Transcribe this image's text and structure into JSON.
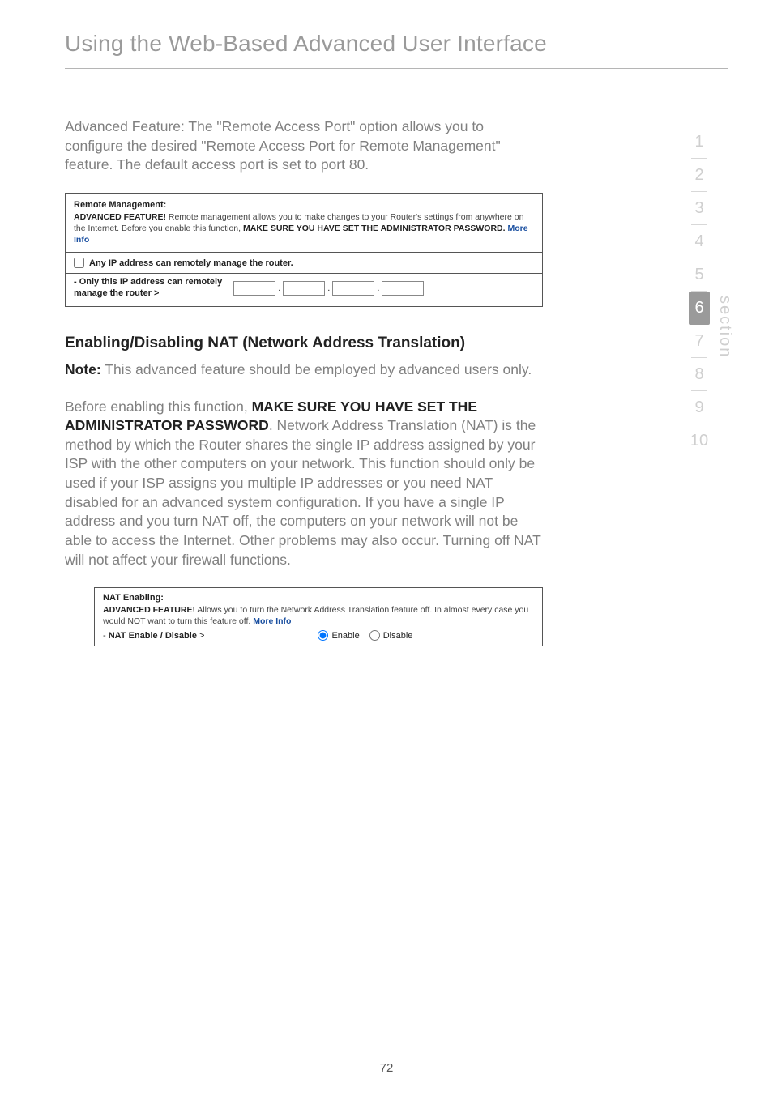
{
  "page_title": "Using the Web-Based Advanced User Interface",
  "intro_para": "Advanced Feature: The \"Remote Access Port\" option allows you to configure the desired \"Remote Access Port for Remote Management\" feature. The default access port is set to port 80.",
  "remote_panel": {
    "heading": "Remote Management:",
    "text_pre": "ADVANCED FEATURE!",
    "text_mid": " Remote management allows you to make changes to your Router's settings from anywhere on the Internet. Before you enable this function, ",
    "text_bold2": "MAKE SURE YOU HAVE SET THE ADMINISTRATOR PASSWORD.",
    "more_info": "More Info",
    "checkbox_label": "Any IP address can remotely manage the router.",
    "ip_label_line1": "- Only this IP address can remotely",
    "ip_label_line2": "manage the router >"
  },
  "nat_heading": "Enabling/Disabling NAT (Network Address Translation)",
  "nat_note_bold": "Note:",
  "nat_note_rest": " This advanced feature should be employed by advanced users only.",
  "nat_para_pre": "Before enabling this function, ",
  "nat_para_bold": "MAKE SURE YOU HAVE SET THE ADMINISTRATOR PASSWORD",
  "nat_para_rest": ". Network Address Translation (NAT) is the method by which the Router shares the single IP address assigned by your ISP with the other computers on your network. This function should only be used if your ISP assigns you multiple IP addresses or you need NAT disabled for an advanced system configuration. If you have a single IP address and you turn NAT off, the computers on your network will not be able to access the Internet. Other problems may also occur. Turning off NAT will not affect your firewall functions.",
  "nat_panel": {
    "heading": "NAT Enabling:",
    "text_pre": "ADVANCED FEATURE!",
    "text_mid": " Allows you to turn the Network Address Translation feature off. In almost every case you would NOT want to turn this feature off. ",
    "more_info": "More Info",
    "row_label": "- NAT Enable / Disable >",
    "enable": "Enable",
    "disable": "Disable"
  },
  "side_nav": {
    "items": [
      "1",
      "2",
      "3",
      "4",
      "5",
      "6",
      "7",
      "8",
      "9",
      "10"
    ],
    "active_index": 5,
    "label": "section"
  },
  "page_number": "72"
}
